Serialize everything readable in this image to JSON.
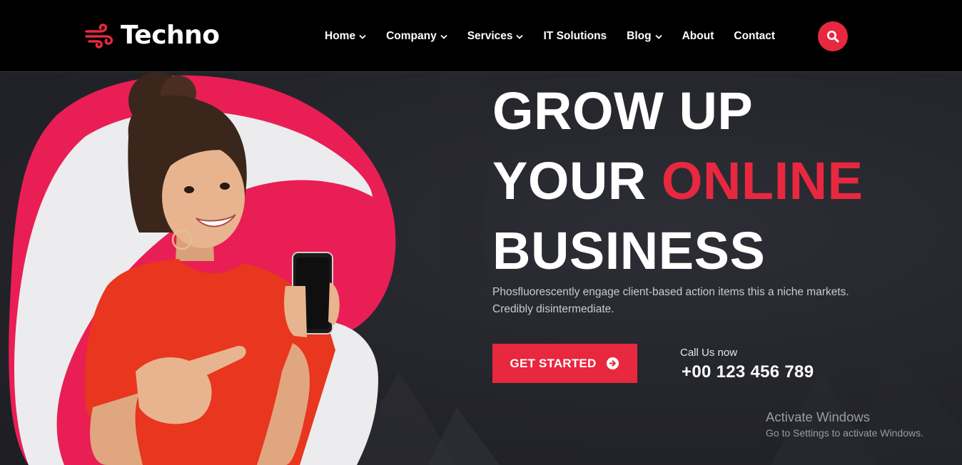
{
  "brand": {
    "name": "Techno",
    "accent_color": "#e8283f",
    "icon": "wind-logo-icon"
  },
  "nav": [
    {
      "label": "Home",
      "has_dropdown": true
    },
    {
      "label": "Company",
      "has_dropdown": true
    },
    {
      "label": "Services",
      "has_dropdown": true
    },
    {
      "label": "IT Solutions",
      "has_dropdown": false
    },
    {
      "label": "Blog",
      "has_dropdown": true
    },
    {
      "label": "About",
      "has_dropdown": false
    },
    {
      "label": "Contact",
      "has_dropdown": false
    }
  ],
  "search": {
    "icon": "search-icon"
  },
  "hero": {
    "headline": {
      "line1": "GROW UP",
      "line2_prefix": "YOUR",
      "line2_accent": "ONLINE",
      "line3": "BUSINESS"
    },
    "description_line1": "Phosfluorescently engage client-based action items this a niche markets.",
    "description_line2": "Credibly disintermediate.",
    "cta_label": "GET STARTED",
    "cta_icon": "arrow-circle-right-icon",
    "call_label": "Call Us now",
    "call_number": "+00 123 456 789"
  },
  "watermark": {
    "title": "Activate Windows",
    "subtitle": "Go to Settings to activate Windows."
  }
}
